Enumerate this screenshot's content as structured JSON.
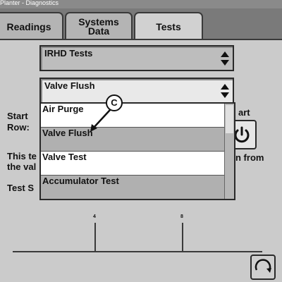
{
  "window": {
    "title": "Planter - Diagnostics"
  },
  "tabs": [
    {
      "label": "Readings",
      "active": false
    },
    {
      "label_line1": "Systems",
      "label_line2": "Data",
      "active": false
    },
    {
      "label": "Tests",
      "active": true
    }
  ],
  "test_group_select": {
    "value": "IRHD Tests",
    "icon": "up-down-arrows-icon"
  },
  "test_select": {
    "value": "Valve Flush",
    "icon": "up-down-arrows-icon"
  },
  "dropdown": {
    "options": [
      {
        "label": "Air Purge"
      },
      {
        "label": "Valve Flush",
        "selected": true
      },
      {
        "label": "Valve Test"
      },
      {
        "label": "Accumulator Test"
      }
    ]
  },
  "callout": {
    "label": "C"
  },
  "start_row": {
    "line1": "Start",
    "line2": "Row:"
  },
  "start": {
    "label": "art",
    "icon": "power-icon"
  },
  "description": {
    "line1": "This te",
    "line2": "the val",
    "right_text": "n from"
  },
  "test_status": {
    "label": "Test S"
  },
  "gauge": {
    "tick_labels": [
      "4",
      "8"
    ]
  },
  "refresh": {
    "icon": "refresh-icon"
  },
  "colors": {
    "background": "#c9c9c9",
    "selected_option": "#b0b0b0",
    "title_bar": "#8a8a8a"
  }
}
